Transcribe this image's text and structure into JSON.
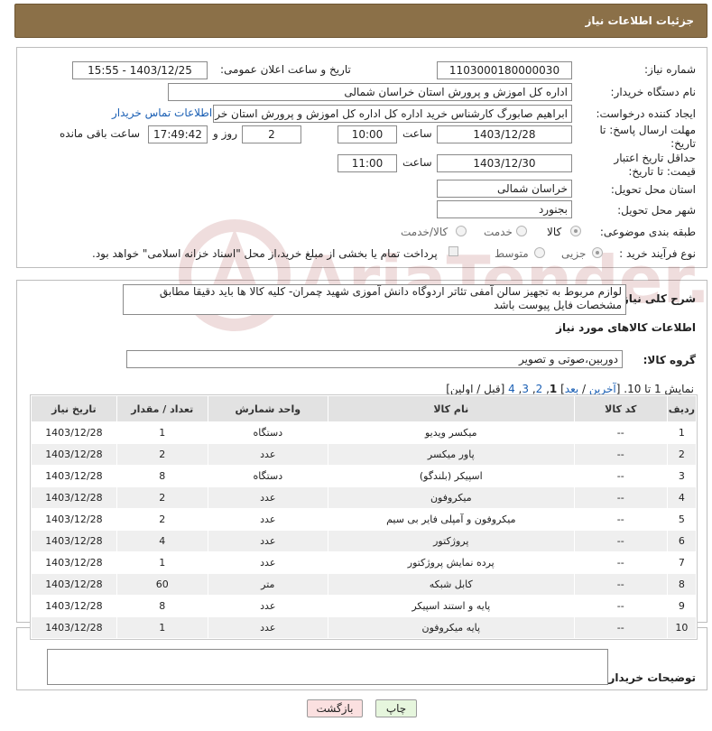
{
  "header": {
    "title": "جزئیات اطلاعات نیاز"
  },
  "form": {
    "need_number": {
      "label": "شماره نیاز:",
      "value": "1103000180000030"
    },
    "announce_datetime": {
      "label": "تاریخ و ساعت اعلان عمومی:",
      "value": "1403/12/25 - 15:55"
    },
    "buyer_org": {
      "label": "نام دستگاه خریدار:",
      "value": "اداره کل اموزش و پرورش استان خراسان شمالی"
    },
    "requester": {
      "label": "ایجاد کننده درخواست:",
      "value": "ابراهیم صابورگ کارشناس خرید اداره کل اداره کل اموزش و پرورش استان خراسان",
      "contact_link": "اطلاعات تماس خریدار"
    },
    "reply_deadline": {
      "label": "مهلت ارسال پاسخ: تا تاریخ:",
      "date": "1403/12/28",
      "time_label": "ساعت",
      "time": "10:00",
      "days": "2",
      "days_label": "روز و",
      "remaining": "17:49:42",
      "remaining_label": "ساعت باقی مانده"
    },
    "price_validity": {
      "label": "حداقل تاریخ اعتبار قیمت: تا تاریخ:",
      "date": "1403/12/30",
      "time_label": "ساعت",
      "time": "11:00"
    },
    "delivery_province": {
      "label": "استان محل تحویل:",
      "value": "خراسان شمالی"
    },
    "delivery_city": {
      "label": "شهر محل تحویل:",
      "value": "بجنورد"
    },
    "category": {
      "label": "طبقه بندی موضوعی:",
      "options": [
        "کالا",
        "خدمت",
        "کالا/خدمت"
      ],
      "selected": "کالا"
    },
    "purchase_type": {
      "label": "نوع فرآیند خرید :",
      "options": [
        "جزیی",
        "متوسط"
      ],
      "selected": "جزیی",
      "payment_note": "پرداخت تمام یا بخشی از مبلغ خرید،از محل \"اسناد خزانه اسلامی\" خواهد بود."
    }
  },
  "description": {
    "label": "شرح کلی نیاز:",
    "text": "لوازم مربوط به تجهیز سالن آمفی تئاتر اردوگاه دانش آموزی شهید چمران- کلیه کالا ها باید دقیقا مطابق مشخصات فایل پیوست باشد"
  },
  "goods": {
    "section_title": "اطلاعات کالاهای مورد نیاز",
    "group_label": "گروه کالا:",
    "group_value": "دوربین،صوتی و تصویر",
    "pagination": {
      "prefix": "نمایش 1 تا 10. [",
      "last": "آخرین",
      "sep1": " / ",
      "next": "بعد",
      "pages_open": "] ",
      "current": "1",
      "p2": "2",
      "p3": "3",
      "p4": "4",
      "suffix": " [قبل / اولین]"
    },
    "columns": [
      "ردیف",
      "کد کالا",
      "نام کالا",
      "واحد شمارش",
      "تعداد / مقدار",
      "تاریخ نیاز"
    ],
    "rows": [
      [
        "1",
        "--",
        "میکسر ویدیو",
        "دستگاه",
        "1",
        "1403/12/28"
      ],
      [
        "2",
        "--",
        "پاور میکسر",
        "عدد",
        "2",
        "1403/12/28"
      ],
      [
        "3",
        "--",
        "اسپیکر (بلندگو)",
        "دستگاه",
        "8",
        "1403/12/28"
      ],
      [
        "4",
        "--",
        "میکروفون",
        "عدد",
        "2",
        "1403/12/28"
      ],
      [
        "5",
        "--",
        "میکروفون و آمپلی فایر بی سیم",
        "عدد",
        "2",
        "1403/12/28"
      ],
      [
        "6",
        "--",
        "پروژکتور",
        "عدد",
        "4",
        "1403/12/28"
      ],
      [
        "7",
        "--",
        "پرده نمایش پروژکتور",
        "عدد",
        "1",
        "1403/12/28"
      ],
      [
        "8",
        "--",
        "کابل شبکه",
        "متر",
        "60",
        "1403/12/28"
      ],
      [
        "9",
        "--",
        "پایه و استند اسپیکر",
        "عدد",
        "8",
        "1403/12/28"
      ],
      [
        "10",
        "--",
        "پایه میکروفون",
        "عدد",
        "1",
        "1403/12/28"
      ]
    ]
  },
  "buyer_notes": {
    "label": "توضیحات خریدار:",
    "value": ""
  },
  "buttons": {
    "print": "چاپ",
    "back": "بازگشت"
  },
  "watermark": {
    "text": "AriaTender.neT"
  }
}
